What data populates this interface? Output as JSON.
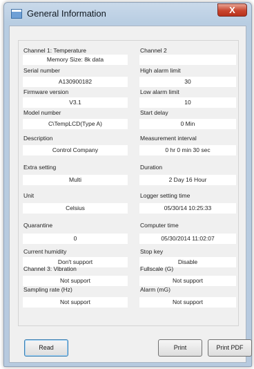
{
  "window": {
    "title": "General Information",
    "close_glyph": "X"
  },
  "fields": {
    "channel1_label": "Channel 1: Temperature",
    "channel1_value": "Memory Size: 8k data",
    "channel2_label": "Channel 2",
    "channel2_value": "",
    "serial_label": "Serial number",
    "serial_value": "A130900182",
    "high_alarm_label": "High alarm limit",
    "high_alarm_value": "30",
    "firmware_label": "Firmware version",
    "firmware_value": "V3.1",
    "low_alarm_label": "Low alarm limit",
    "low_alarm_value": "10",
    "model_label": "Model number",
    "model_value": "C\\TempLCD(Type A)",
    "start_delay_label": "Start delay",
    "start_delay_value": "0 Min",
    "description_label": "Description",
    "description_value": "Control Company",
    "interval_label": "Measurement interval",
    "interval_value": "0 hr 0 min 30 sec",
    "extra_label": "Extra setting",
    "extra_value": "Multi",
    "duration_label": "Duration",
    "duration_value": "2 Day 16 Hour",
    "unit_label": "Unit",
    "unit_value": "Celsius",
    "logger_time_label": "Logger setting time",
    "logger_time_value": "05/30/14 10:25:33",
    "quarantine_label": "Quarantine",
    "quarantine_value": "0",
    "computer_time_label": "Computer time",
    "computer_time_value": "05/30/2014 11:02:07",
    "humidity_label": "Current humidity",
    "humidity_value": "Don't support",
    "stop_key_label": "Stop key",
    "stop_key_value": "Disable",
    "channel3_label": "Channel 3: Vibration",
    "channel3_value": "Not support",
    "fullscale_label": "Fullscale (G)",
    "fullscale_value": "Not support",
    "sampling_label": "Sampling rate (Hz)",
    "sampling_value": "Not support",
    "alarm_mg_label": "Alarm (mG)",
    "alarm_mg_value": "Not support"
  },
  "buttons": {
    "read": "Read",
    "print": "Print",
    "print_pdf": "Print PDF"
  },
  "icons": {
    "title_icon": "window-app-icon",
    "close_icon": "close-icon"
  },
  "colors": {
    "close_red": "#c8462f",
    "frame": "#b8cde2",
    "client": "#f0f0f0"
  }
}
